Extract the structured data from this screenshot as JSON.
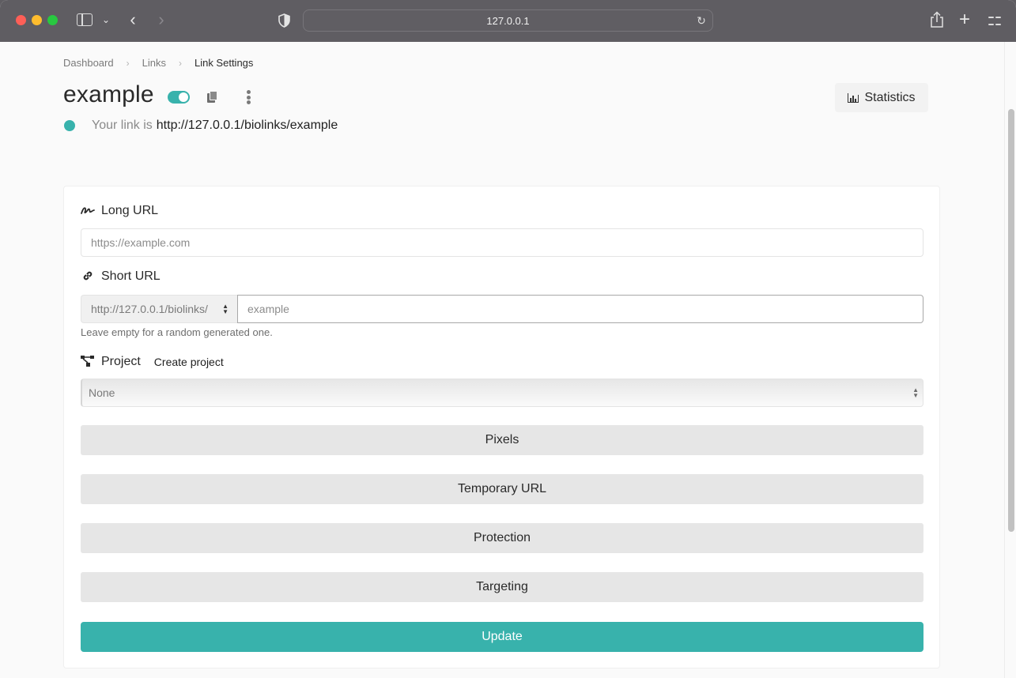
{
  "browser": {
    "address": "127.0.0.1",
    "icons": [
      "sidebar-icon",
      "chevron-down-icon",
      "back-icon",
      "forward-icon",
      "shield-icon",
      "reload-icon",
      "share-icon",
      "new-tab-icon",
      "tab-overview-icon"
    ]
  },
  "breadcrumb": {
    "items": [
      "Dashboard",
      "Links",
      "Link Settings"
    ],
    "separator": "›"
  },
  "header": {
    "title": "example",
    "enabled": true,
    "link_prefix": "Your link is",
    "link_url": "http://127.0.0.1/biolinks/example",
    "statistics_label": "Statistics",
    "accent_color": "#38b2ac"
  },
  "form": {
    "long_url": {
      "label": "Long URL",
      "value": "",
      "placeholder": "https://example.com"
    },
    "short_url": {
      "label": "Short URL",
      "domain_selected": "http://127.0.0.1/biolinks/",
      "value": "",
      "placeholder": "example",
      "help": "Leave empty for a random generated one."
    },
    "project": {
      "label": "Project",
      "create_label": "Create project",
      "selected": "None"
    },
    "sections": [
      "Pixels",
      "Temporary URL",
      "Protection",
      "Targeting"
    ],
    "submit_label": "Update"
  }
}
